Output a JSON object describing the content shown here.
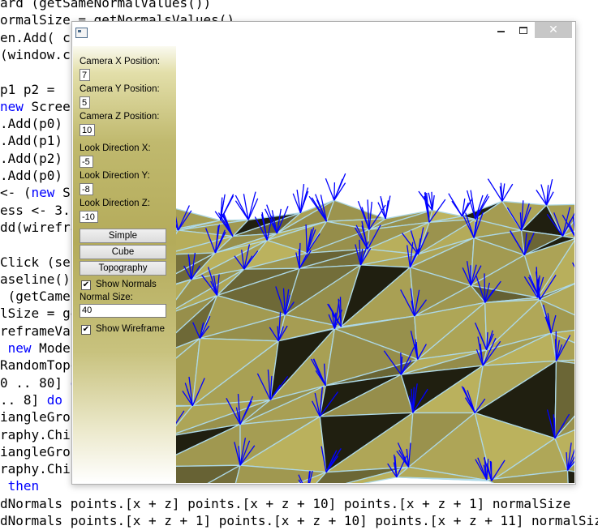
{
  "code_lines": [
    {
      "pre": "ard (getSameNormalValues())",
      "kw": "",
      "post": ""
    },
    {
      "pre": "ormalSize = getNormalsValues()",
      "kw": "",
      "post": ""
    },
    {
      "pre": "en.Add( cu",
      "kw": "",
      "post": ""
    },
    {
      "pre": "(window.cu",
      "kw": "",
      "post": ""
    },
    {
      "pre": "",
      "kw": "",
      "post": ""
    },
    {
      "pre": "p1 p2 =",
      "kw": "",
      "post": ""
    },
    {
      "pre": "",
      "kw": "new",
      "post": " Screen"
    },
    {
      "pre": ".Add(p0)",
      "kw": "",
      "post": ""
    },
    {
      "pre": ".Add(p1)",
      "kw": "",
      "post": ""
    },
    {
      "pre": ".Add(p2)",
      "kw": "",
      "post": ""
    },
    {
      "pre": ".Add(p0)",
      "kw": "",
      "post": ""
    },
    {
      "pre": "<- (",
      "kw": "new",
      "post": " Sc"
    },
    {
      "pre": "ess <- 3.",
      "kw": "",
      "post": ""
    },
    {
      "pre": "dd(wirefra",
      "kw": "",
      "post": ""
    },
    {
      "pre": "",
      "kw": "",
      "post": ""
    },
    {
      "pre": "Click (ser",
      "kw": "",
      "post": ""
    },
    {
      "pre": "aseline()",
      "kw": "",
      "post": ""
    },
    {
      "pre": " (getCamer",
      "kw": "",
      "post": ""
    },
    {
      "pre": "lSize = ge",
      "kw": "",
      "post": ""
    },
    {
      "pre": "reframeVal",
      "kw": "",
      "post": ""
    },
    {
      "pre": " ",
      "kw": "new",
      "post": " Model"
    },
    {
      "pre": "RandomTopo",
      "kw": "",
      "post": ""
    },
    {
      "pre": "0 .. 80] ",
      "kw": "d",
      "post": ""
    },
    {
      "pre": ".. 8] ",
      "kw": "do",
      "post": ""
    },
    {
      "pre": "iangleGrou",
      "kw": "",
      "post": ""
    },
    {
      "pre": "raphy.Chil",
      "kw": "",
      "post": ""
    },
    {
      "pre": "iangleGrou",
      "kw": "",
      "post": ""
    },
    {
      "pre": "raphy.Chil",
      "kw": "",
      "post": ""
    },
    {
      "pre": " ",
      "kw": "then",
      "post": ""
    },
    {
      "pre": "dNormals points.[x + z] points.[x + z + 10] points.[x + z + 1] normalSize",
      "kw": "",
      "post": ""
    },
    {
      "pre": "dNormals points.[x + z + 1] points.[x + z + 10] points.[x + z + 11] normalSize",
      "kw": "",
      "post": ""
    }
  ],
  "window": {
    "minimize_label": "",
    "maximize_label": "",
    "close_label": "✕"
  },
  "sidebar": {
    "camera_x_label": "Camera X Position:",
    "camera_x_value": "7",
    "camera_y_label": "Camera Y Position:",
    "camera_y_value": "5",
    "camera_z_label": "Camera Z Position:",
    "camera_z_value": "10",
    "look_x_label": "Look Direction X:",
    "look_x_value": "-5",
    "look_y_label": "Look Direction Y:",
    "look_y_value": "-8",
    "look_z_label": "Look Direction Z:",
    "look_z_value": "-10",
    "simple_button": "Simple",
    "cube_button": "Cube",
    "topography_button": "Topography",
    "show_normals_label": "Show Normals",
    "show_normals_checked": true,
    "normal_size_label": "Normal Size:",
    "normal_size_value": "40",
    "show_wireframe_label": "Show Wireframe",
    "show_wireframe_checked": true
  },
  "colors": {
    "surface_base": "#b4ab5a",
    "wireframe": "#add8e6",
    "normals": "#0000ff",
    "shadow": "#2c2a18"
  }
}
